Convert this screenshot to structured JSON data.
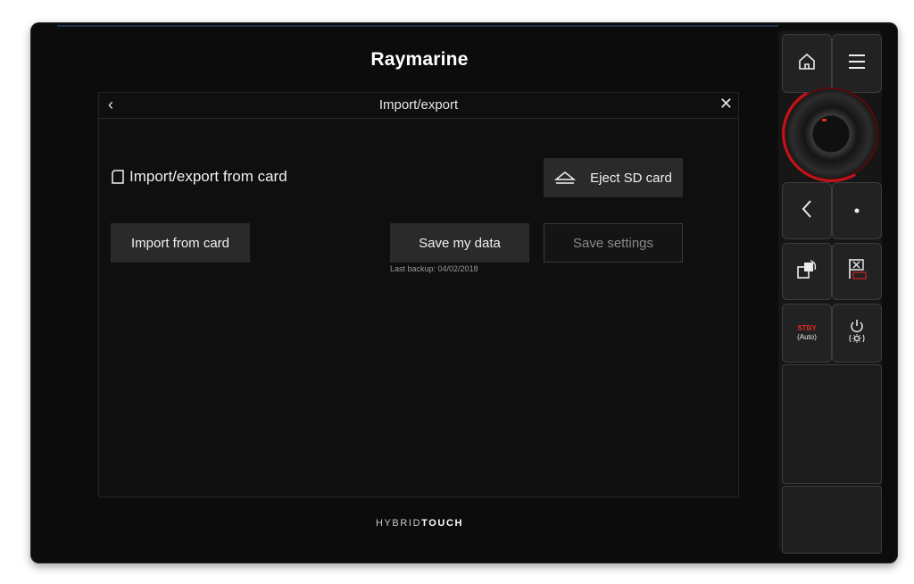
{
  "device": {
    "brand": "Raymarine",
    "hybrid_prefix": "HYBRID",
    "hybrid_suffix": "TOUCH"
  },
  "screen": {
    "title": "Import/export",
    "back_icon": "chevron-left-icon",
    "close_icon": "close-icon",
    "section_title": "Import/export from card",
    "buttons": {
      "eject": "Eject SD card",
      "import": "Import from card",
      "save_data": "Save my data",
      "save_settings": "Save settings"
    },
    "last_backup": "Last backup: 04/02/2018"
  },
  "keys": {
    "stby": "STBY",
    "auto": "(Auto)"
  }
}
